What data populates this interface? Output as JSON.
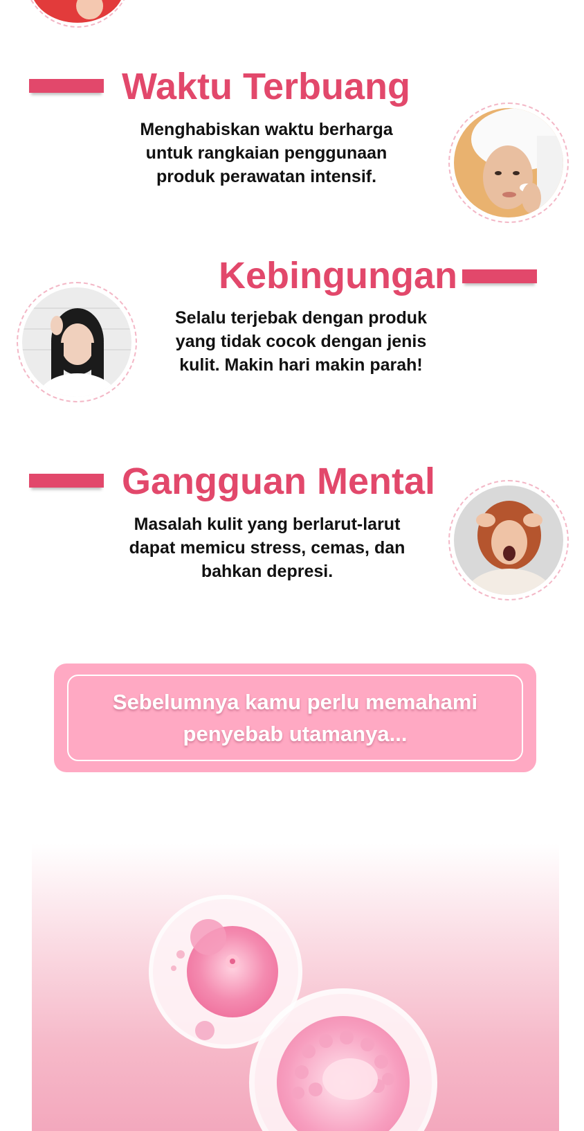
{
  "sections": [
    {
      "heading": "Waktu Terbuang",
      "description": "Menghabiskan waktu berharga untuk rangkaian penggunaan produk perawatan intensif.",
      "image": "woman-towel-face-roller"
    },
    {
      "heading": "Kebingungan",
      "description": "Selalu terjebak dengan produk yang tidak cocok dengan jenis kulit. Makin hari makin parah!",
      "image": "confused-woman"
    },
    {
      "heading": "Gangguan Mental",
      "description": "Masalah kulit yang berlarut-larut dapat memicu stress, cemas, dan bahkan depresi.",
      "image": "stressed-woman-screaming"
    }
  ],
  "callout": {
    "text": "Sebelumnya kamu perlu memahami penyebab utamanya..."
  },
  "hero": {
    "image": "pink-skin-cells"
  },
  "colors": {
    "accent": "#e2486b",
    "callout_bg": "#ffa9c3",
    "circle_border": "#f3b7c6"
  }
}
